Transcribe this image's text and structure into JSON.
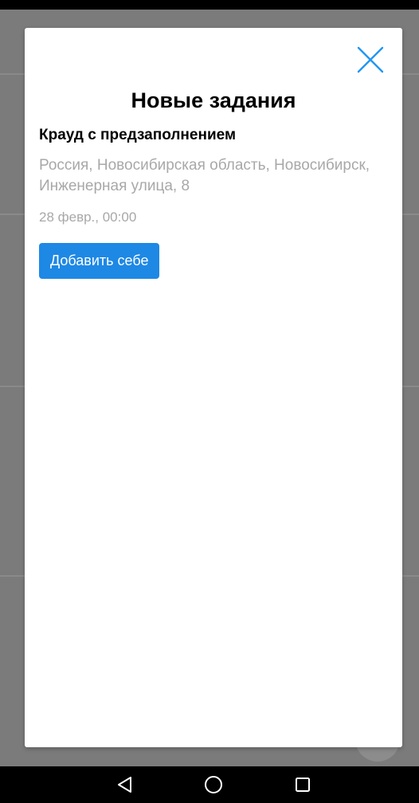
{
  "modal": {
    "title": "Новые задания",
    "task": {
      "title": "Крауд с предзаполнением",
      "address": "Россия, Новосибирская область, Новосибирск, Инженерная улица, 8",
      "date": "28 февр., 00:00",
      "action_label": "Добавить себе"
    },
    "close_icon": "close-icon"
  },
  "navigation_bar": {
    "icons": [
      "back-icon",
      "home-icon",
      "recents-icon"
    ]
  },
  "colors": {
    "accent": "#1e88e5",
    "close_icon": "#2196f3",
    "secondary_text": "#a8a8a8",
    "overlay": "#7b7b7b"
  }
}
